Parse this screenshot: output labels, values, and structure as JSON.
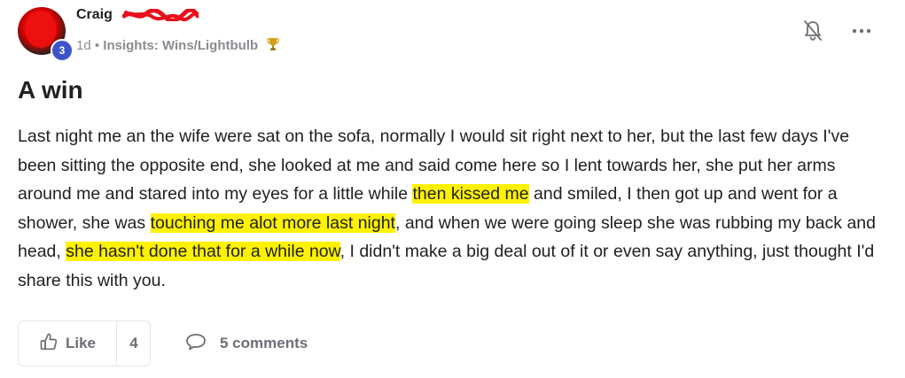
{
  "author": {
    "name": "Craig",
    "level": "3"
  },
  "meta": {
    "time": "1d",
    "separator": "•",
    "category": "Insights: Wins/Lightbulb",
    "category_icon": "trophy-icon"
  },
  "header_actions": {
    "bell_icon": "bell-icon",
    "more_icon": "more-horizontal-icon"
  },
  "post": {
    "title": "A win",
    "body": {
      "seg1": "Last night me an the wife were sat on the sofa, normally I would sit right next to her, but the last few days I've been sitting the opposite end, she looked at me and said come here so I lent towards her, she put her arms around me and stared into my eyes for a little while ",
      "hl1": "then kissed me",
      "seg2": " and smiled, I then got up and went for a shower, she was ",
      "hl2": "touching me alot more last night",
      "seg3": ", and when we were going sleep she was rubbing my back and head, ",
      "hl3": "she hasn't done that for a while now",
      "seg4": ", I didn't make a big deal out of it or even say anything, just thought I'd share this with you."
    }
  },
  "actions": {
    "like_label": "Like",
    "like_count": "4",
    "comments_label": "5 comments"
  },
  "colors": {
    "highlight": "#fff200",
    "badge": "#3b55c9",
    "muted": "#8a8d91",
    "redaction": "#e8101b"
  }
}
